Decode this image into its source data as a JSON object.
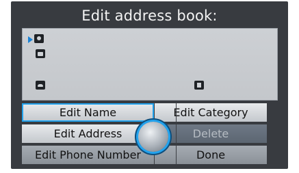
{
  "screen": {
    "title": "Edit address book:"
  },
  "entry_icons": {
    "row1": [
      "person-icon"
    ],
    "row2": [
      "home-icon"
    ],
    "row3": [
      "phone-icon",
      "note-icon"
    ]
  },
  "menu": {
    "edit_name": "Edit Name",
    "edit_category": "Edit Category",
    "edit_address": "Edit Address",
    "delete": "Delete",
    "edit_phone_number": "Edit Phone Number",
    "done": "Done"
  },
  "colors": {
    "accent": "#22a3ee",
    "panel": "#c8cbd0",
    "bezel": "#383b40"
  }
}
